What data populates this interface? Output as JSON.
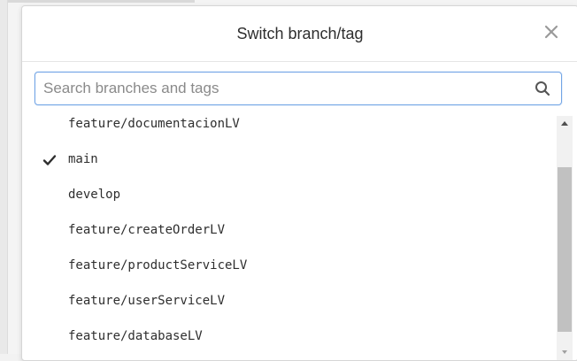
{
  "modal": {
    "title": "Switch branch/tag"
  },
  "search": {
    "placeholder": "Search branches and tags",
    "value": ""
  },
  "branches": [
    {
      "label": "feature/documentacionLV",
      "selected": false
    },
    {
      "label": "main",
      "selected": true
    },
    {
      "label": "develop",
      "selected": false
    },
    {
      "label": "feature/createOrderLV",
      "selected": false
    },
    {
      "label": "feature/productServiceLV",
      "selected": false
    },
    {
      "label": "feature/userServiceLV",
      "selected": false
    },
    {
      "label": "feature/databaseLV",
      "selected": false
    }
  ],
  "icons": {
    "close": "close-icon",
    "search": "search-icon",
    "selected": "checkmark-icon",
    "scroll_up": "arrow-up-icon",
    "scroll_down": "arrow-down-icon"
  },
  "colors": {
    "focus_border": "#73a5e6",
    "text": "#2e2e2e",
    "placeholder": "#8a8a8a"
  }
}
